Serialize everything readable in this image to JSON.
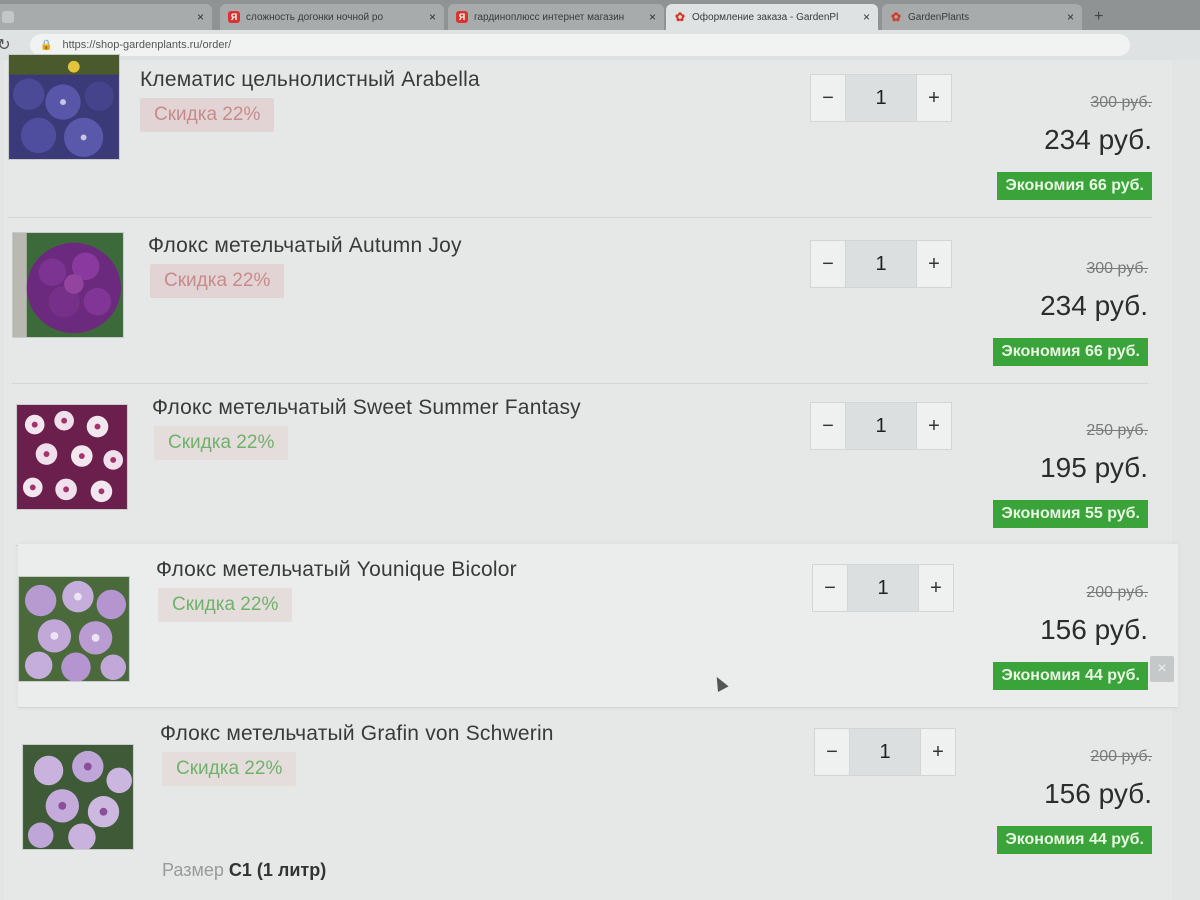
{
  "browser": {
    "tabs": [
      {
        "label": "",
        "favicon": "blank",
        "active": false
      },
      {
        "label": "сложность догонки ночной ро",
        "favicon": "yandex",
        "active": false
      },
      {
        "label": "гардиноплюсс интернет магазин",
        "favicon": "yandex",
        "active": false
      },
      {
        "label": "Оформление заказа - GardenPl",
        "favicon": "leaf",
        "active": true
      },
      {
        "label": "GardenPlants",
        "favicon": "leaf",
        "active": false
      }
    ],
    "url": "https://shop-gardenplants.ru/order/",
    "reload_icon": "reload-icon",
    "lock_icon": "lock-icon"
  },
  "cart": {
    "items": [
      {
        "name": "Клематис цельнолистный Arabella",
        "discount": "Скидка 22%",
        "qty": "1",
        "old_price": "300 руб.",
        "new_price": "234 руб.",
        "savings": "Экономия 66 руб."
      },
      {
        "name": "Флокс метельчатый Autumn Joy",
        "discount": "Скидка 22%",
        "qty": "1",
        "old_price": "300 руб.",
        "new_price": "234 руб.",
        "savings": "Экономия 66 руб."
      },
      {
        "name": "Флокс метельчатый Sweet Summer Fantasy",
        "discount": "Скидка 22%",
        "qty": "1",
        "old_price": "250 руб.",
        "new_price": "195 руб.",
        "savings": "Экономия 55 руб."
      },
      {
        "name": "Флокс метельчатый Younique Bicolor",
        "discount": "Скидка 22%",
        "qty": "1",
        "old_price": "200 руб.",
        "new_price": "156 руб.",
        "savings": "Экономия 44 руб."
      },
      {
        "name": "Флокс метельчатый Grafin von Schwerin",
        "discount": "Скидка 22%",
        "qty": "1",
        "old_price": "200 руб.",
        "new_price": "156 руб.",
        "savings": "Экономия 44 руб."
      }
    ],
    "minus": "−",
    "plus": "+",
    "remove": "×",
    "size_label": "Размер",
    "size_value": "C1 (1 литр)"
  },
  "colors": {
    "savings_bg": "#3aa339",
    "discount_text": "#6fb36a"
  }
}
